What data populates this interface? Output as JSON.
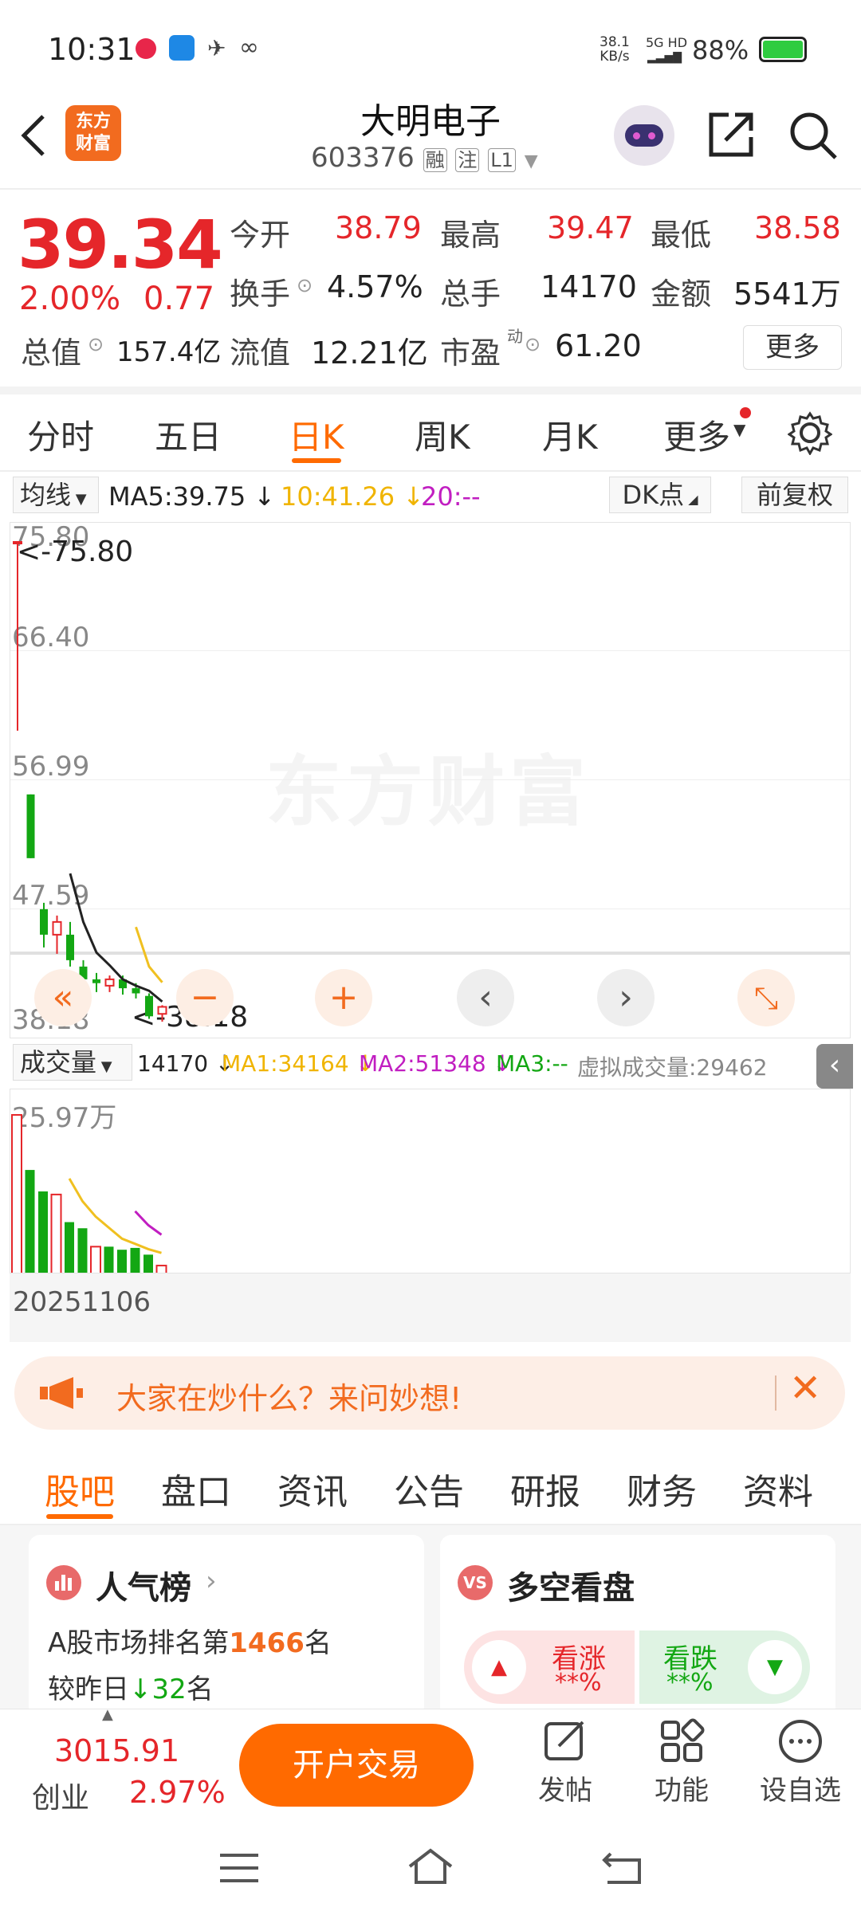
{
  "status_bar": {
    "time": "10:31",
    "net_speed_top": "38.1",
    "net_speed_bottom": "KB/s",
    "signal": "5G HD",
    "battery": "88%"
  },
  "header": {
    "title": "大明电子",
    "code": "603376",
    "tag1": "融",
    "tag2": "注",
    "tag3": "L1",
    "logo_top": "东方",
    "logo_bottom": "财富"
  },
  "quote": {
    "price": "39.34",
    "pct": "2.00%",
    "chg": "0.77",
    "open_label": "今开",
    "open": "38.79",
    "high_label": "最高",
    "high": "39.47",
    "low_label": "最低",
    "low": "38.58",
    "turnover_label": "换手",
    "turnover": "4.57%",
    "volume_label": "总手",
    "volume": "14170",
    "amount_label": "金额",
    "amount": "5541万",
    "mcap_label": "总值",
    "mcap": "157.4亿",
    "float_label": "流值",
    "float": "12.21亿",
    "pe_label": "市盈",
    "pe_sup": "动",
    "pe": "61.20",
    "more": "更多"
  },
  "period_tabs": [
    "分时",
    "五日",
    "日K",
    "周K",
    "月K",
    "更多"
  ],
  "ma_bar": {
    "label": "均线",
    "ma5": "MA5:39.75 ↓",
    "ma10": "10:41.26 ↓",
    "ma20": "20:--",
    "dk": "DK点",
    "adjust": "前复权"
  },
  "kline": {
    "y_labels": [
      "75.80",
      "66.40",
      "56.99",
      "47.59",
      "38.18"
    ],
    "max_note": "<-75.80",
    "min_note": "<-38.18",
    "watermark": "东方财富"
  },
  "vol_bar": {
    "label": "成交量",
    "vol": "14170 ↓",
    "ma1": "MA1:34164 ↓",
    "ma2": "MA2:51348 ↓",
    "ma3": "MA3:--",
    "virtual": "虚拟成交量:29462"
  },
  "volume_chart": {
    "max_label": "25.97万",
    "date": "20251106"
  },
  "banner": {
    "text": "大家在炒什么？来问妙想!"
  },
  "sub_tabs": [
    "股吧",
    "盘口",
    "资讯",
    "公告",
    "研报",
    "财务",
    "资料"
  ],
  "popularity": {
    "title": "人气榜",
    "line1_prefix": "A股市场排名第",
    "rank": "1466",
    "line1_suffix": "名",
    "line2_prefix": "较昨日",
    "change": "32",
    "line2_suffix": "名"
  },
  "sentiment": {
    "title": "多空看盘",
    "up_label": "看涨",
    "up_value": "**%",
    "down_label": "看跌",
    "down_value": "**%"
  },
  "bottom": {
    "index_value": "3015.91",
    "index_name": "创业",
    "index_pct": "2.97%",
    "trade_button": "开户交易",
    "post": "发帖",
    "features": "功能",
    "add_watch": "设自选"
  },
  "chart_data": {
    "type": "candlestick",
    "ylim": [
      38.18,
      75.8
    ],
    "candles": [
      {
        "o": 75.8,
        "c": 75.8,
        "h": 75.8,
        "l": 61.0,
        "color": "red"
      },
      {
        "o": 56.0,
        "c": 51.0,
        "h": 56.0,
        "l": 51.0,
        "color": "green"
      },
      {
        "o": 47.0,
        "c": 45.0,
        "h": 47.5,
        "l": 44.0,
        "color": "green"
      },
      {
        "o": 45.0,
        "c": 46.0,
        "h": 46.5,
        "l": 43.5,
        "color": "red"
      },
      {
        "o": 45.0,
        "c": 43.0,
        "h": 46.0,
        "l": 42.5,
        "color": "green"
      },
      {
        "o": 42.5,
        "c": 41.5,
        "h": 43.0,
        "l": 40.8,
        "color": "green"
      },
      {
        "o": 41.5,
        "c": 41.2,
        "h": 42.0,
        "l": 40.5,
        "color": "green"
      },
      {
        "o": 41.0,
        "c": 41.5,
        "h": 41.8,
        "l": 40.5,
        "color": "red"
      },
      {
        "o": 41.5,
        "c": 40.8,
        "h": 41.8,
        "l": 40.3,
        "color": "green"
      },
      {
        "o": 40.8,
        "c": 40.4,
        "h": 41.2,
        "l": 40.0,
        "color": "green"
      },
      {
        "o": 40.2,
        "c": 38.6,
        "h": 40.4,
        "l": 38.4,
        "color": "green"
      },
      {
        "o": 38.79,
        "c": 39.34,
        "h": 39.47,
        "l": 38.18,
        "color": "red"
      }
    ],
    "ma5": [
      null,
      null,
      null,
      null,
      49.8,
      46.0,
      43.6,
      42.6,
      41.5,
      41.0,
      40.6,
      39.75
    ],
    "ma10": [
      null,
      null,
      null,
      null,
      null,
      null,
      null,
      null,
      null,
      45.6,
      42.5,
      41.26
    ],
    "volumes": [
      25.97,
      17.0,
      13.5,
      13.0,
      8.5,
      7.5,
      4.5,
      4.5,
      4.0,
      4.3,
      3.2,
      1.42
    ],
    "vol_colors": [
      "red",
      "green",
      "green",
      "red",
      "green",
      "green",
      "red",
      "green",
      "green",
      "green",
      "green",
      "red"
    ]
  }
}
